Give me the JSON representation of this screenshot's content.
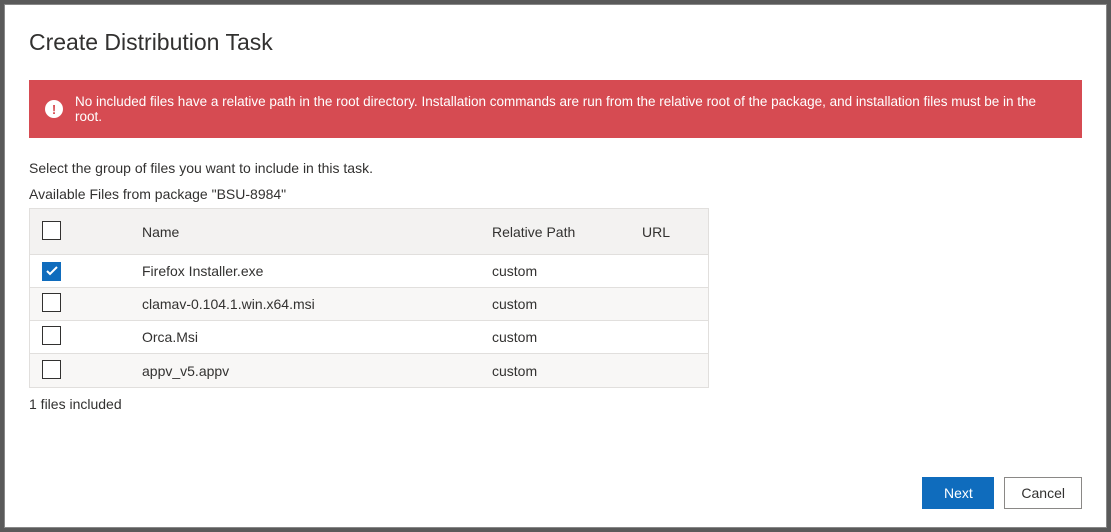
{
  "title": "Create Distribution Task",
  "alert": {
    "message": "No included files have a relative path in the root directory. Installation commands are run from the relative root of the package, and installation files must be in the root."
  },
  "instruction": "Select the group of files you want to include in this task.",
  "available_label": "Available Files from package \"BSU-8984\"",
  "columns": {
    "name": "Name",
    "relative_path": "Relative Path",
    "url": "URL"
  },
  "rows": [
    {
      "checked": true,
      "name": "Firefox Installer.exe",
      "relative_path": "custom",
      "url": ""
    },
    {
      "checked": false,
      "name": "clamav-0.104.1.win.x64.msi",
      "relative_path": "custom",
      "url": ""
    },
    {
      "checked": false,
      "name": "Orca.Msi",
      "relative_path": "custom",
      "url": ""
    },
    {
      "checked": false,
      "name": "appv_v5.appv",
      "relative_path": "custom",
      "url": ""
    }
  ],
  "included_summary": "1 files included",
  "buttons": {
    "next": "Next",
    "cancel": "Cancel"
  }
}
